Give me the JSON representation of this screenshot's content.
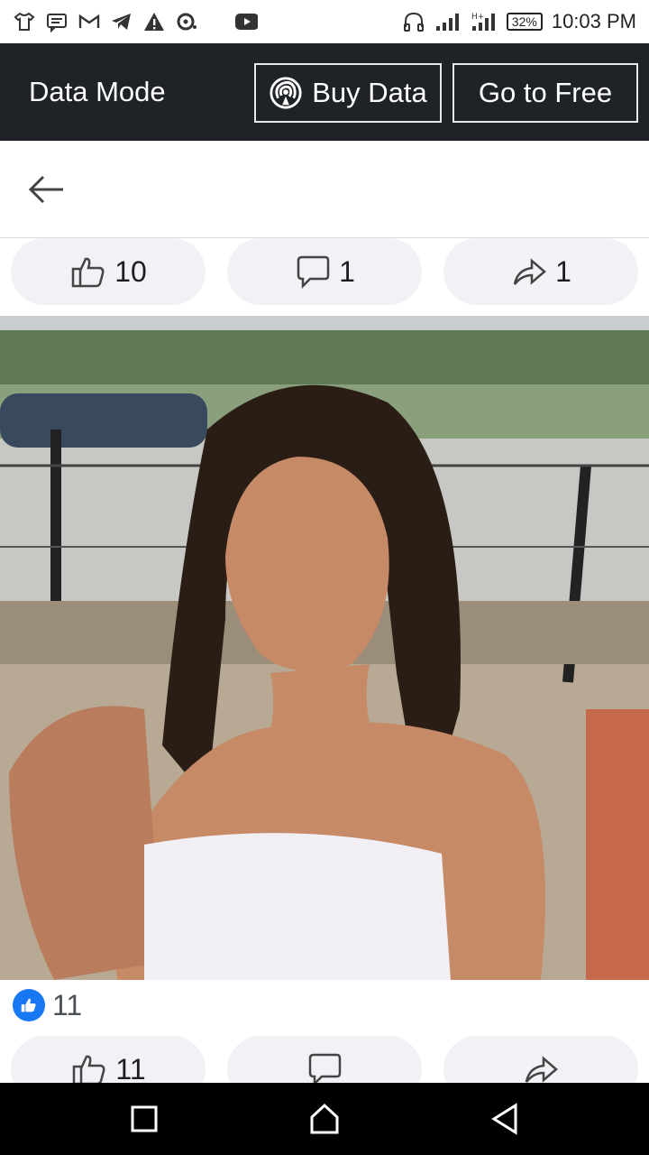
{
  "status_bar": {
    "battery": "32%",
    "time": "10:03 PM",
    "icons": [
      "shirt-icon",
      "message-icon",
      "gmail-icon",
      "telegram-icon",
      "warning-icon",
      "media-icon",
      "youtube-icon",
      "headphones-icon",
      "signal-icon",
      "signal-ht-icon",
      "battery-icon"
    ]
  },
  "data_bar": {
    "title": "Data Mode",
    "buy_label": "Buy Data",
    "free_label": "Go to Free"
  },
  "header": {
    "back_icon": "arrow-left-icon"
  },
  "post1": {
    "like_count": "10",
    "comment_count": "1",
    "share_count": "1"
  },
  "post2": {
    "reaction_count": "11",
    "like_count": "11"
  },
  "colors": {
    "data_bar": "#1f2328",
    "accent": "#1877f2",
    "pill": "#f0f2f5"
  }
}
